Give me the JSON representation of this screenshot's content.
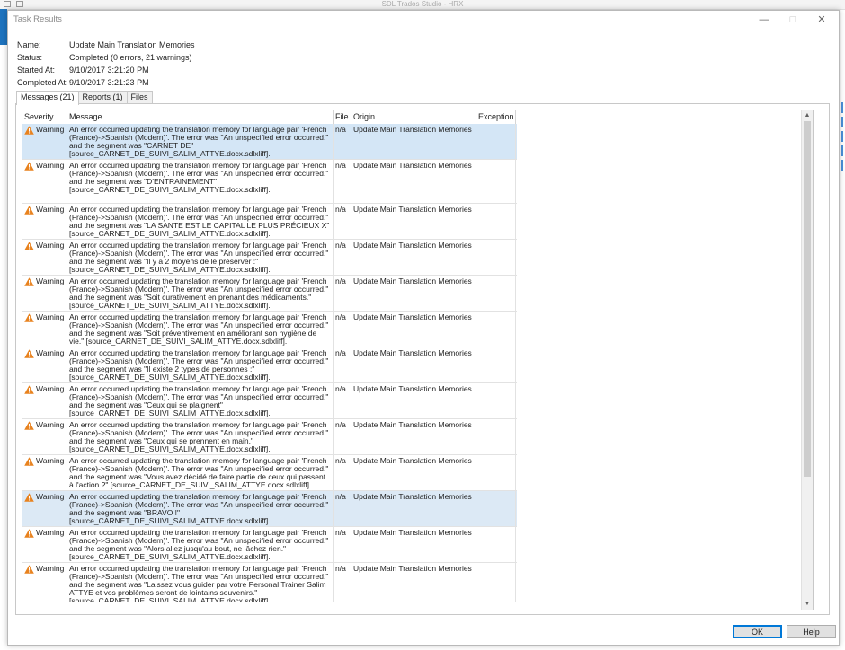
{
  "background_app": {
    "title": "SDL Trados Studio - HRX"
  },
  "dialog": {
    "title": "Task Results",
    "info": [
      {
        "label": "Name:",
        "value": "Update Main Translation Memories"
      },
      {
        "label": "Status:",
        "value": "Completed (0 errors, 21 warnings)"
      },
      {
        "label": "Started At:",
        "value": "9/10/2017 3:21:20 PM"
      },
      {
        "label": "Completed At:",
        "value": "9/10/2017 3:21:23 PM"
      }
    ],
    "tabs": [
      "Messages (21)",
      "Reports (1)",
      "Files"
    ],
    "columns": [
      "Severity",
      "Message",
      "File",
      "Origin",
      "Exception"
    ],
    "rows": [
      {
        "severity": "Warning",
        "message": "An error occurred updating the translation memory for language pair 'French (France)->Spanish (Modern)'. The error was \"An unspecified error occurred.\" and the segment was \"CARNET DE\" [source_CARNET_DE_SUIVI_SALIM_ATTYE.docx.sdlxliff].",
        "file": "n/a",
        "origin": "Update Main Translation Memories",
        "exception": ""
      },
      {
        "severity": "Warning",
        "message": "An error occurred updating the translation memory for language pair 'French (France)->Spanish (Modern)'. The error was \"An unspecified error occurred.\" and the segment was \"D'ENTRAINEMENT\" [source_CARNET_DE_SUIVI_SALIM_ATTYE.docx.sdlxliff].",
        "file": "n/a",
        "origin": "Update Main Translation Memories",
        "exception": ""
      },
      {
        "severity": "Warning",
        "message": "An error occurred updating the translation memory for language pair 'French (France)->Spanish (Modern)'. The error was \"An unspecified error occurred.\" and the segment was \"LA SANTE EST LE CAPITAL LE PLUS PRÉCIEUX X\" [source_CARNET_DE_SUIVI_SALIM_ATTYE.docx.sdlxliff].",
        "file": "n/a",
        "origin": "Update Main Translation Memories",
        "exception": ""
      },
      {
        "severity": "Warning",
        "message": "An error occurred updating the translation memory for language pair 'French (France)->Spanish (Modern)'. The error was \"An unspecified error occurred.\" and the segment was \"Il y a 2 moyens de le préserver :\" [source_CARNET_DE_SUIVI_SALIM_ATTYE.docx.sdlxliff].",
        "file": "n/a",
        "origin": "Update Main Translation Memories",
        "exception": ""
      },
      {
        "severity": "Warning",
        "message": "An error occurred updating the translation memory for language pair 'French (France)->Spanish (Modern)'. The error was \"An unspecified error occurred.\" and the segment was \"Soit curativement en prenant des médicaments.\" [source_CARNET_DE_SUIVI_SALIM_ATTYE.docx.sdlxliff].",
        "file": "n/a",
        "origin": "Update Main Translation Memories",
        "exception": ""
      },
      {
        "severity": "Warning",
        "message": "An error occurred updating the translation memory for language pair 'French (France)->Spanish (Modern)'. The error was \"An unspecified error occurred.\" and the segment was \"Soit préventivement en améliorant son hygiène de vie.\" [source_CARNET_DE_SUIVI_SALIM_ATTYE.docx.sdlxliff].",
        "file": "n/a",
        "origin": "Update Main Translation Memories",
        "exception": ""
      },
      {
        "severity": "Warning",
        "message": "An error occurred updating the translation memory for language pair 'French (France)->Spanish (Modern)'. The error was \"An unspecified error occurred.\" and the segment was \"Il existe 2 types de personnes :\" [source_CARNET_DE_SUIVI_SALIM_ATTYE.docx.sdlxliff].",
        "file": "n/a",
        "origin": "Update Main Translation Memories",
        "exception": ""
      },
      {
        "severity": "Warning",
        "message": "An error occurred updating the translation memory for language pair 'French (France)->Spanish (Modern)'. The error was \"An unspecified error occurred.\" and the segment was \"Ceux qui se plaignent\" [source_CARNET_DE_SUIVI_SALIM_ATTYE.docx.sdlxliff].",
        "file": "n/a",
        "origin": "Update Main Translation Memories",
        "exception": ""
      },
      {
        "severity": "Warning",
        "message": "An error occurred updating the translation memory for language pair 'French (France)->Spanish (Modern)'. The error was \"An unspecified error occurred.\" and the segment was \"Ceux qui se prennent en main.\" [source_CARNET_DE_SUIVI_SALIM_ATTYE.docx.sdlxliff].",
        "file": "n/a",
        "origin": "Update Main Translation Memories",
        "exception": ""
      },
      {
        "severity": "Warning",
        "message": "An error occurred updating the translation memory for language pair 'French (France)->Spanish (Modern)'. The error was \"An unspecified error occurred.\" and the segment was \"Vous avez décidé de faire partie de ceux qui passent à l'action ?\" [source_CARNET_DE_SUIVI_SALIM_ATTYE.docx.sdlxliff].",
        "file": "n/a",
        "origin": "Update Main Translation Memories",
        "exception": ""
      },
      {
        "severity": "Warning",
        "message": "An error occurred updating the translation memory for language pair 'French (France)->Spanish (Modern)'. The error was \"An unspecified error occurred.\" and the segment was \"BRAVO !\" [source_CARNET_DE_SUIVI_SALIM_ATTYE.docx.sdlxliff].",
        "file": "n/a",
        "origin": "Update Main Translation Memories",
        "exception": ""
      },
      {
        "severity": "Warning",
        "message": "An error occurred updating the translation memory for language pair 'French (France)->Spanish (Modern)'. The error was \"An unspecified error occurred.\" and the segment was \"Alors allez jusqu'au bout, ne lâchez rien.\" [source_CARNET_DE_SUIVI_SALIM_ATTYE.docx.sdlxliff].",
        "file": "n/a",
        "origin": "Update Main Translation Memories",
        "exception": ""
      },
      {
        "severity": "Warning",
        "message": "An error occurred updating the translation memory for language pair 'French (France)->Spanish (Modern)'. The error was \"An unspecified error occurred.\" and the segment was \"Laissez vous guider par votre Personal Trainer Salim ATTYE et vos problèmes seront de lointains souvenirs.\" [source_CARNET_DE_SUIVI_SALIM_ATTYE.docx.sdlxliff].",
        "file": "n/a",
        "origin": "Update Main Translation Memories",
        "exception": ""
      }
    ],
    "buttons": {
      "ok": "OK",
      "help": "Help"
    }
  },
  "colors": {
    "selected_row": "#d4e6f6",
    "warning_icon": "#e8821e",
    "accent": "#0078d7"
  }
}
